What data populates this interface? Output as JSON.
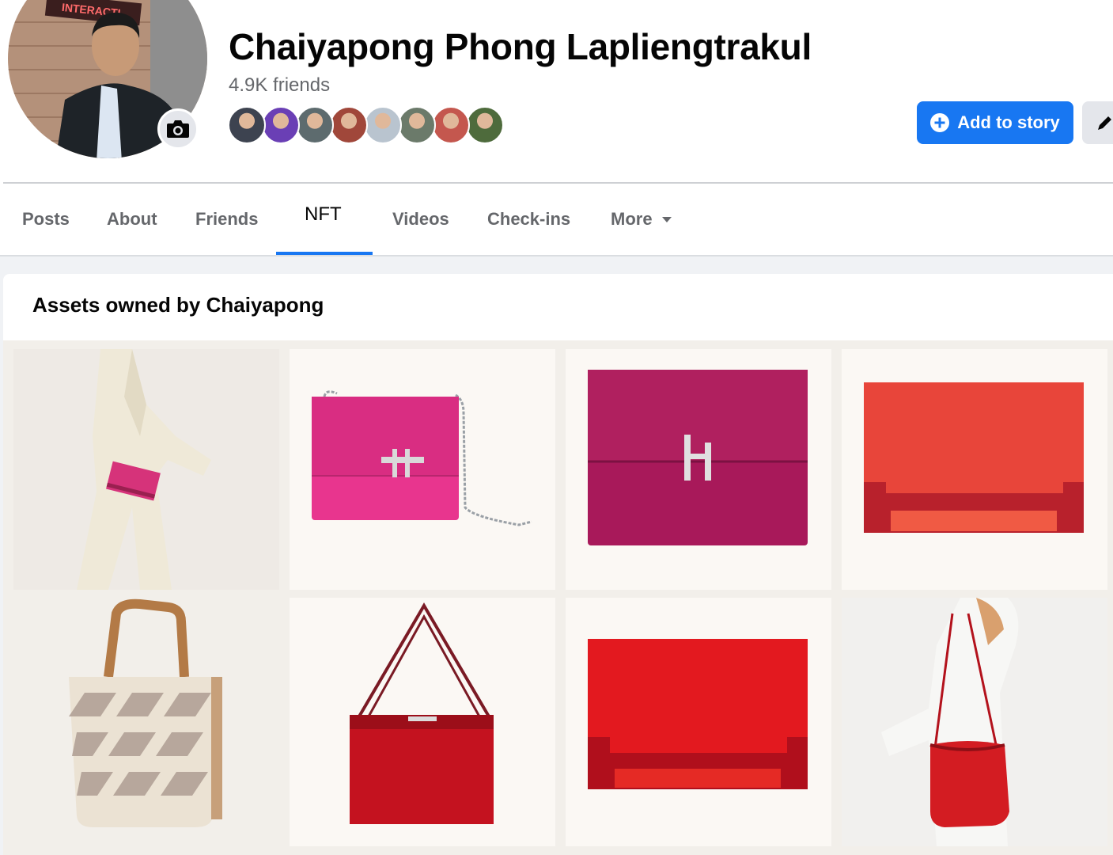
{
  "profile": {
    "name": "Chaiyapong Phong Lapliengtrakul",
    "friend_count": "4.9K friends",
    "avatar_sign": "INTERACTI",
    "friend_avatars": [
      "#3d4350",
      "#6a3fb5",
      "#5d6b6e",
      "#a0473a",
      "#b9c4cf",
      "#6b7a6a",
      "#c4574e",
      "#4e6b3c"
    ]
  },
  "actions": {
    "add_story_label": "Add to story"
  },
  "tabs": [
    {
      "label": "Posts"
    },
    {
      "label": "About"
    },
    {
      "label": "Friends"
    },
    {
      "label": "NFT"
    },
    {
      "label": "Videos"
    },
    {
      "label": "Check-ins"
    },
    {
      "label": "More"
    }
  ],
  "assets": {
    "title": "Assets owned by Chaiyapong",
    "items": [
      {
        "kind": "model-clutch",
        "color": "#d6337a"
      },
      {
        "kind": "chain-bag",
        "color": "#e8358e"
      },
      {
        "kind": "h-clutch",
        "color": "#a8195a"
      },
      {
        "kind": "flap-clutch",
        "color": "#e8453a"
      },
      {
        "kind": "h-tote",
        "color": "#b37a46"
      },
      {
        "kind": "shoulder-bag",
        "color": "#c4121f"
      },
      {
        "kind": "flap-clutch",
        "color": "#e3191f"
      },
      {
        "kind": "model-pouch",
        "color": "#d31c22"
      }
    ]
  },
  "colors": {
    "accent": "#1877f2",
    "text_primary": "#050505",
    "text_secondary": "#65676b"
  }
}
